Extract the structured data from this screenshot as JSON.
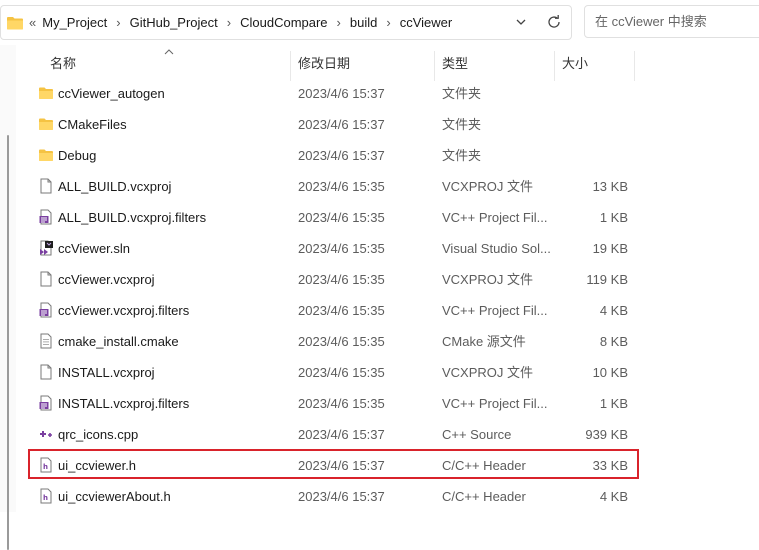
{
  "address": {
    "more": "«",
    "crumbs": [
      "My_Project",
      "GitHub_Project",
      "CloudCompare",
      "build",
      "ccViewer"
    ]
  },
  "search": {
    "placeholder": "在 ccViewer 中搜索"
  },
  "columns": {
    "name": "名称",
    "date": "修改日期",
    "type": "类型",
    "size": "大小"
  },
  "files": [
    {
      "name": "ccViewer_autogen",
      "date": "2023/4/6 15:37",
      "type": "文件夹",
      "size": "",
      "icon": "folder-icon"
    },
    {
      "name": "CMakeFiles",
      "date": "2023/4/6 15:37",
      "type": "文件夹",
      "size": "",
      "icon": "folder-icon"
    },
    {
      "name": "Debug",
      "date": "2023/4/6 15:37",
      "type": "文件夹",
      "size": "",
      "icon": "folder-icon"
    },
    {
      "name": "ALL_BUILD.vcxproj",
      "date": "2023/4/6 15:35",
      "type": "VCXPROJ 文件",
      "size": "13 KB",
      "icon": "file-icon"
    },
    {
      "name": "ALL_BUILD.vcxproj.filters",
      "date": "2023/4/6 15:35",
      "type": "VC++ Project Fil...",
      "size": "1 KB",
      "icon": "filters-file-icon"
    },
    {
      "name": "ccViewer.sln",
      "date": "2023/4/6 15:35",
      "type": "Visual Studio Sol...",
      "size": "19 KB",
      "icon": "visual-studio-solution-icon"
    },
    {
      "name": "ccViewer.vcxproj",
      "date": "2023/4/6 15:35",
      "type": "VCXPROJ 文件",
      "size": "119 KB",
      "icon": "file-icon"
    },
    {
      "name": "ccViewer.vcxproj.filters",
      "date": "2023/4/6 15:35",
      "type": "VC++ Project Fil...",
      "size": "4 KB",
      "icon": "filters-file-icon"
    },
    {
      "name": "cmake_install.cmake",
      "date": "2023/4/6 15:35",
      "type": "CMake 源文件",
      "size": "8 KB",
      "icon": "text-file-icon"
    },
    {
      "name": "INSTALL.vcxproj",
      "date": "2023/4/6 15:35",
      "type": "VCXPROJ 文件",
      "size": "10 KB",
      "icon": "file-icon"
    },
    {
      "name": "INSTALL.vcxproj.filters",
      "date": "2023/4/6 15:35",
      "type": "VC++ Project Fil...",
      "size": "1 KB",
      "icon": "filters-file-icon"
    },
    {
      "name": "qrc_icons.cpp",
      "date": "2023/4/6 15:37",
      "type": "C++ Source",
      "size": "939 KB",
      "icon": "cpp-source-icon"
    },
    {
      "name": "ui_ccviewer.h",
      "date": "2023/4/6 15:37",
      "type": "C/C++ Header",
      "size": "33 KB",
      "icon": "header-file-icon"
    },
    {
      "name": "ui_ccviewerAbout.h",
      "date": "2023/4/6 15:37",
      "type": "C/C++ Header",
      "size": "4 KB",
      "icon": "header-file-icon"
    }
  ],
  "colors": {
    "folder": "#f5c343",
    "highlight": "#d9232b",
    "accent_purple": "#7a3fa0"
  }
}
